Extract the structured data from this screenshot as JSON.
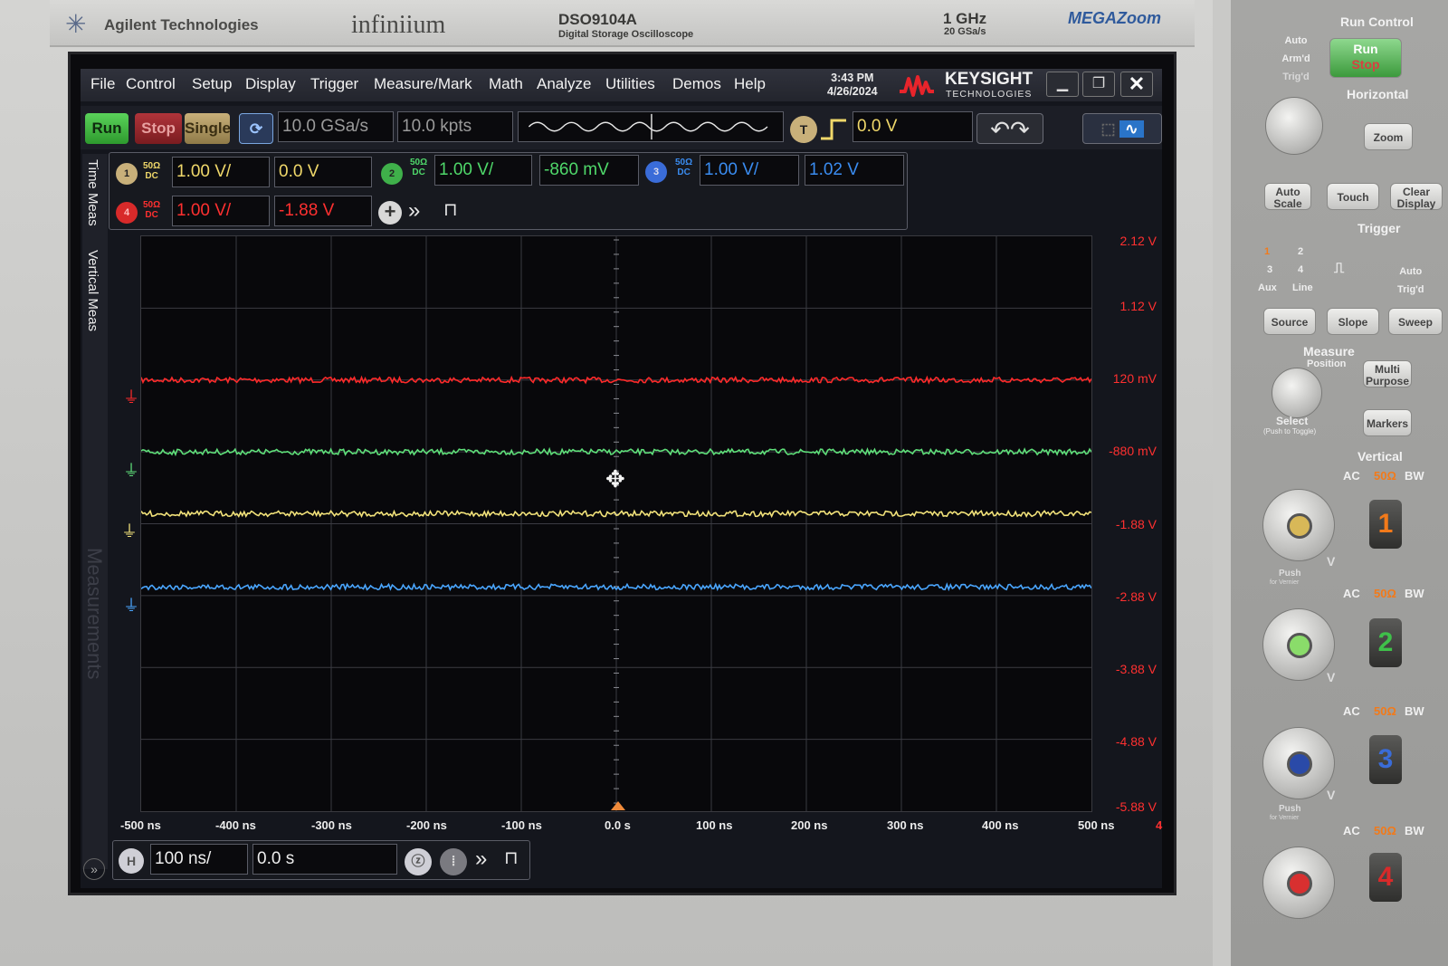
{
  "front_panel": {
    "brand": "Agilent Technologies",
    "series": "infiniium",
    "model": "DSO9104A",
    "model_sub": "Digital Storage Oscilloscope",
    "bandwidth": "1 GHz",
    "sample_rate_spec": "20 GSa/s",
    "megazoom": "MEGAZoom"
  },
  "menubar": {
    "items": [
      "File",
      "Control",
      "Setup",
      "Display",
      "Trigger",
      "Measure/Mark",
      "Math",
      "Analyze",
      "Utilities",
      "Demos",
      "Help"
    ],
    "time": "3:43 PM",
    "date": "4/26/2024",
    "vendor": "KEYSIGHT",
    "vendor_sub": "TECHNOLOGIES"
  },
  "toolbar": {
    "run": "Run",
    "stop": "Stop",
    "single": "Single",
    "sample_rate": "10.0 GSa/s",
    "memory_depth": "10.0 kpts",
    "trigger_badge": "T",
    "trigger_level": "0.0 V"
  },
  "channels": [
    {
      "number": "1",
      "impedance": "50Ω",
      "coupling": "DC",
      "scale": "1.00 V/",
      "offset": "0.0 V",
      "color": "#f0d86a"
    },
    {
      "number": "2",
      "impedance": "50Ω",
      "coupling": "DC",
      "scale": "1.00 V/",
      "offset": "-860 mV",
      "color": "#4fd86a"
    },
    {
      "number": "3",
      "impedance": "50Ω",
      "coupling": "DC",
      "scale": "1.00 V/",
      "offset": "1.02 V",
      "color": "#3a8cf0"
    },
    {
      "number": "4",
      "impedance": "50Ω",
      "coupling": "DC",
      "scale": "1.00 V/",
      "offset": "-1.88 V",
      "color": "#ff3030"
    }
  ],
  "side_tabs": [
    "Time Meas",
    "Vertical Meas",
    "Measurements"
  ],
  "scale_labels": [
    "2.12 V",
    "1.12 V",
    "120 mV",
    "-880 mV",
    "-1.88 V",
    "-2.88 V",
    "-3.88 V",
    "-4.88 V",
    "-5.88 V"
  ],
  "time_labels": [
    "-500 ns",
    "-400 ns",
    "-300 ns",
    "-200 ns",
    "-100 ns",
    "0.0 s",
    "100 ns",
    "200 ns",
    "300 ns",
    "400 ns",
    "500 ns"
  ],
  "time_axis_channel": "4",
  "horizontal": {
    "badge": "H",
    "scale": "100 ns/",
    "position": "0.0 s"
  },
  "traces": [
    {
      "channel": "4",
      "level_v": 0.12,
      "color": "#ff2a2a"
    },
    {
      "channel": "2",
      "level_v": -0.88,
      "color": "#5fe07a"
    },
    {
      "channel": "1",
      "level_v": -1.74,
      "color": "#f2e27a"
    },
    {
      "channel": "3",
      "level_v": -2.76,
      "color": "#4aa6ff"
    }
  ],
  "right_panel": {
    "run_control": "Run Control",
    "auto_status": [
      "Auto",
      "Arm'd",
      "Trig'd"
    ],
    "run_stop": [
      "Run",
      "Stop"
    ],
    "horizontal": "Horizontal",
    "zoom": "Zoom",
    "auto_scale": [
      "Auto",
      "Scale"
    ],
    "touch": "Touch",
    "clear_display": [
      "Clear",
      "Display"
    ],
    "trigger": "Trigger",
    "trigger_sources": [
      "1",
      "2",
      "3",
      "4",
      "Aux",
      "Line"
    ],
    "trig_mode": [
      "Auto",
      "Trig'd"
    ],
    "source": "Source",
    "slope": "Slope",
    "sweep": "Sweep",
    "measure": "Measure",
    "position": "Position",
    "multi_purpose": [
      "Multi",
      "Purpose"
    ],
    "select": "Select",
    "push_to_toggle": "(Push to Toggle)",
    "markers": "Markers",
    "vertical": "Vertical",
    "ac": "AC",
    "impedance": "50Ω",
    "bw": "BW",
    "push": "Push",
    "for_vernier": "for Vernier",
    "v": "V",
    "channel_numbers": [
      "1",
      "2",
      "3",
      "4"
    ],
    "channel_colors": [
      "#f27a1a",
      "#3fc04a",
      "#3a6cd8",
      "#d82a2a"
    ]
  }
}
